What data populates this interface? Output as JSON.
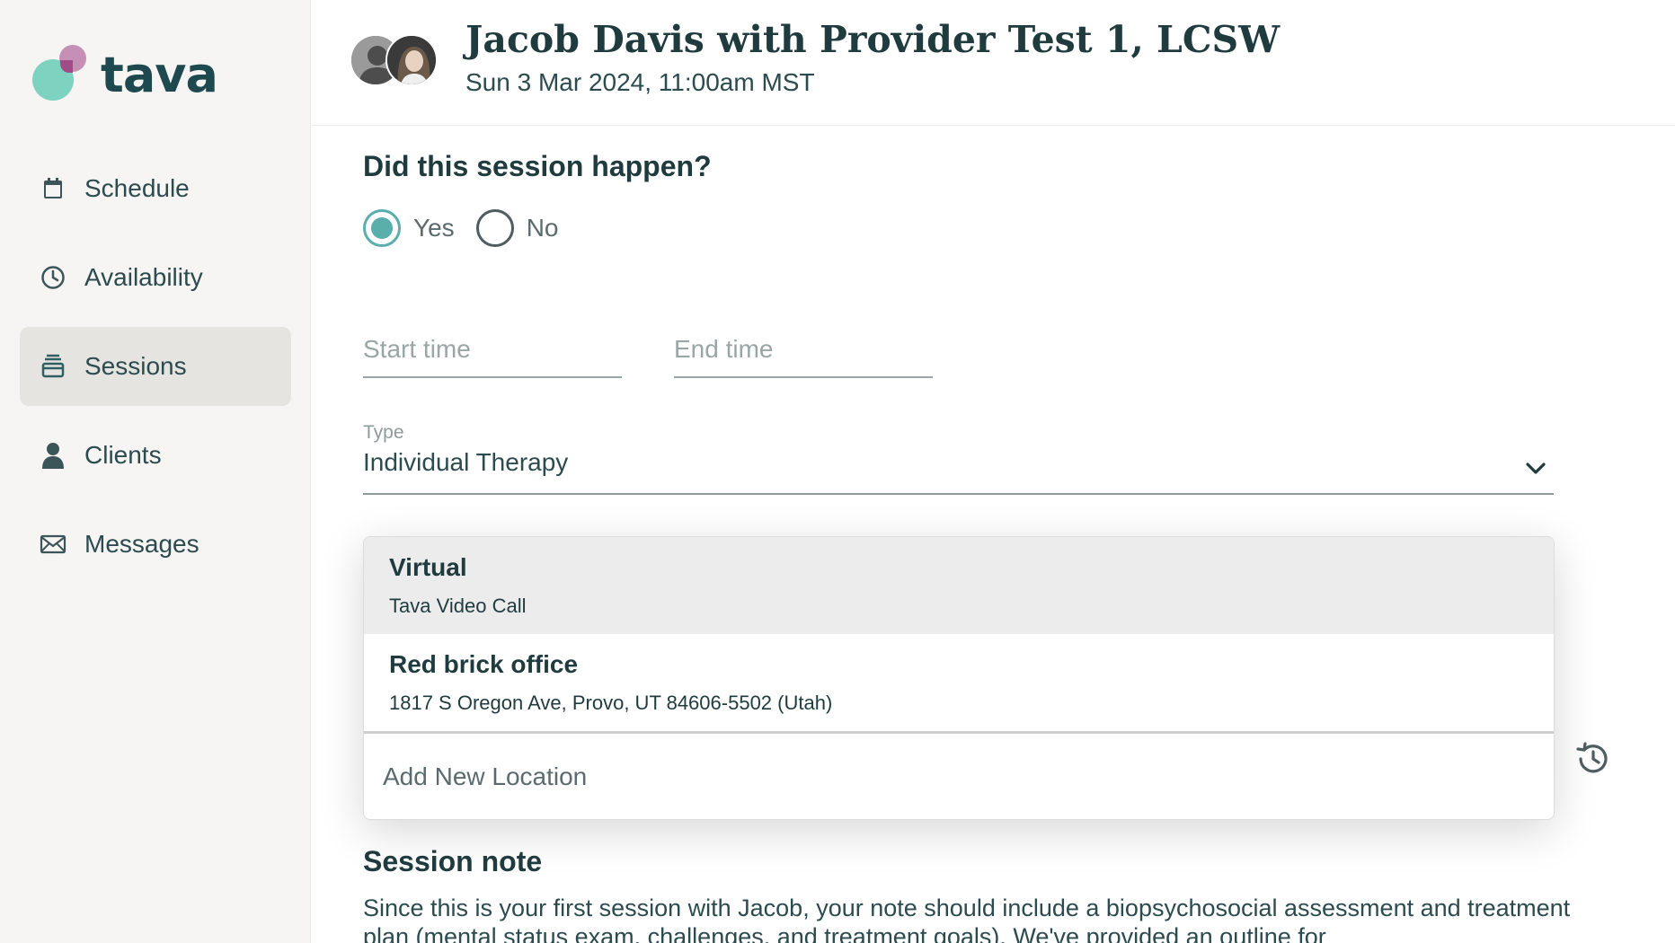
{
  "brand": {
    "name": "tava"
  },
  "nav": {
    "items": [
      {
        "label": "Schedule",
        "icon": "calendar-icon"
      },
      {
        "label": "Availability",
        "icon": "clock-icon"
      },
      {
        "label": "Sessions",
        "icon": "sessions-icon",
        "active": true
      },
      {
        "label": "Clients",
        "icon": "person-icon"
      },
      {
        "label": "Messages",
        "icon": "envelope-icon"
      }
    ]
  },
  "header": {
    "title": "Jacob Davis with Provider Test 1, LCSW",
    "subtitle": "Sun 3 Mar 2024, 11:00am MST"
  },
  "form": {
    "question": "Did this session happen?",
    "radio": {
      "yes": "Yes",
      "no": "No",
      "selected": "Yes"
    },
    "start_time_placeholder": "Start time",
    "end_time_placeholder": "End time",
    "type_label": "Type",
    "type_value": "Individual Therapy"
  },
  "locations": {
    "options": [
      {
        "title": "Virtual",
        "detail": "Tava Video Call"
      },
      {
        "title": "Red brick office",
        "detail": "1817 S Oregon Ave, Provo, UT 84606-5502 (Utah)"
      }
    ],
    "add_label": "Add New Location"
  },
  "note": {
    "title": "Session note",
    "text": "Since this is your first session with Jacob, your note should include a biopsychosocial assessment and treatment plan (mental status exam, challenges, and treatment goals). We've provided an outline for"
  },
  "colors": {
    "accent": "#5aaeac",
    "sidebar_bg": "#f6f5f3",
    "active_nav_bg": "#e6e4e1",
    "text_primary": "#1f3b3e"
  }
}
